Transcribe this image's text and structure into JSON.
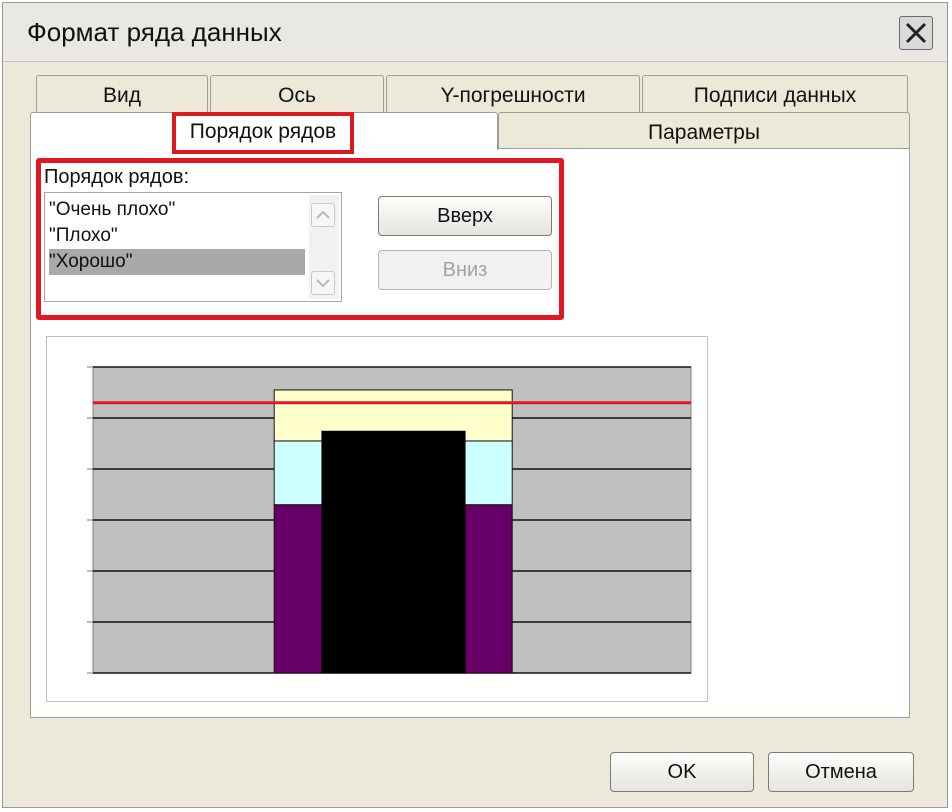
{
  "window": {
    "title": "Формат ряда данных"
  },
  "tabs": {
    "row1": [
      "Вид",
      "Ось",
      "Y-погрешности",
      "Подписи данных"
    ],
    "row2_active": "Порядок рядов",
    "row2_other": "Параметры"
  },
  "series_order": {
    "label": "Порядок рядов:",
    "items": [
      "\"Очень плохо\"",
      "\"Плохо\"",
      "\"Хорошо\""
    ],
    "selected_index": 2
  },
  "buttons": {
    "up": "Вверх",
    "down": "Вниз",
    "ok": "OK",
    "cancel": "Отмена"
  },
  "icons": [
    "close-icon",
    "scroll-up-arrow-icon",
    "scroll-down-arrow-icon"
  ],
  "colors": {
    "highlight": "#e01822",
    "plot_bg": "#c0c0c0",
    "series_purple": "#660066",
    "series_lightcyan": "#ccffff",
    "series_lightyellow": "#ffffcc",
    "overlay_black": "#000000",
    "red_line": "#e01822"
  },
  "chart_data": {
    "type": "bar",
    "stacked": true,
    "gridlines": 7,
    "stack_segments": [
      {
        "color": "#660066",
        "value": 3.3
      },
      {
        "color": "#ccffff",
        "value": 1.25
      },
      {
        "color": "#ffffcc",
        "value": 1.0
      }
    ],
    "overlay_bar": {
      "color": "#000000",
      "value": 4.75
    },
    "reference_line": {
      "color": "#e01822",
      "value": 5.3
    },
    "ylim": [
      0,
      6
    ]
  }
}
